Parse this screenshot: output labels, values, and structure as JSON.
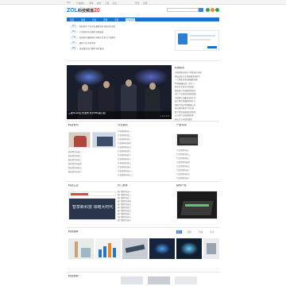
{
  "topbar": {
    "links": [
      "ZOL",
      "产品报价",
      "评测",
      "资讯",
      "下载",
      "论坛",
      "登录",
      "注册"
    ]
  },
  "header": {
    "logo_main": "ZOL",
    "logo_sub": "科技频道",
    "logo_badge": "20",
    "search_placeholder": "",
    "social_colors": [
      "#2aa54a",
      "#f28a1d",
      "#2aa54a"
    ]
  },
  "nav": {
    "items": [
      "首页",
      "新闻",
      "行业",
      "评测",
      "手机",
      "科技频道"
    ]
  },
  "hot_topics": {
    "rows": [
      {
        "tag": "热点",
        "text": "科技资讯 今日头条 最新消息 科技前沿动态"
      },
      {
        "tag": "焦点",
        "text": "行业新闻 每日更新 深度报道"
      },
      {
        "tag": "产品",
        "text": "新品发布 最新科技 科技生活 热门产品推荐"
      },
      {
        "tag": "热门",
        "text": "数码产品 评测 导购"
      },
      {
        "tag": "推荐",
        "text": "科技频道 热门推荐 资讯 报道"
      }
    ]
  },
  "hero": {
    "caption": "三星Note9正式发布 售价999美元起",
    "pager": "1 2 3 4 5"
  },
  "right_news": {
    "title": "科技新闻",
    "items": [
      {
        "text": "全国首家实体无人零售商店亮相",
        "red": true
      },
      {
        "text": "科技改变生活 智能家居新时代",
        "red": false
      },
      {
        "text": "人工智能技术发展最新进展",
        "red": false
      },
      {
        "text": "5G网络覆盖进一步扩大",
        "red": false
      },
      {
        "text": "科技企业发布年度财报",
        "red": false
      },
      {
        "text": "新能源汽车销量持续增长",
        "red": true
      },
      {
        "text": "芯片产业迎来新发展机遇",
        "red": false
      },
      {
        "text": "互联网行业最新动态汇总",
        "red": false
      },
      {
        "text": "云计算市场规模持续扩大",
        "red": false
      },
      {
        "text": "智能手机出货量数据公布",
        "red": false
      },
      {
        "text": "科技创新推动产业升级",
        "red": false
      },
      {
        "text": "数字经济发展迎来新阶段",
        "red": false
      },
      {
        "text": "无人机行业发展新趋势",
        "red": true
      },
      {
        "text": "科技巨头布局新领域",
        "red": false
      }
    ]
  },
  "sections": {
    "col1_title": "科技资讯",
    "col2_title": "行业新闻",
    "col3_title": "产品评测",
    "col1_items": [
      "科技资讯内容一",
      "科技资讯内容二",
      "科技资讯内容三",
      "科技资讯内容四",
      "科技资讯内容五",
      "科技资讯内容六"
    ],
    "col2_items": [
      "行业新闻内容一",
      "行业新闻内容二",
      "行业新闻内容三",
      "行业新闻内容四",
      "行业新闻内容五",
      "行业新闻内容六",
      "行业新闻内容七",
      "行业新闻内容八",
      "行业新闻内容九",
      "行业新闻内容十",
      "行业新闻内容十一",
      "行业新闻内容十二"
    ],
    "col3_items": [
      "产品评测内容一",
      "产品评测内容二",
      "产品评测内容三",
      "产品评测内容四",
      "产品评测内容五",
      "产品评测内容六",
      "产品评测内容七",
      "产品评测内容八"
    ]
  },
  "row2": {
    "col1_title": "科技生活",
    "col2_title": "热门推荐",
    "col3_title": "数码产品",
    "banner_text": "智享新科技 领略大时代",
    "col2_items": [
      "热门推荐内容一",
      "热门推荐内容二",
      "热门推荐内容三",
      "热门推荐内容四",
      "热门推荐内容五",
      "热门推荐内容六",
      "热门推荐内容七",
      "热门推荐内容八",
      "热门推荐内容九",
      "热门推荐内容十"
    ],
    "col3_items": [
      "数码产品内容一",
      "数码产品内容二",
      "数码产品内容三"
    ]
  },
  "gallery": {
    "title": "科技图库",
    "tabs": [
      "推荐",
      "数码",
      "科技",
      "生活"
    ],
    "captions": [
      "图集一",
      "图集二",
      "图集三",
      "图集四",
      "图集五",
      "图集六"
    ]
  },
  "bottom": {
    "title": "科技频道"
  }
}
